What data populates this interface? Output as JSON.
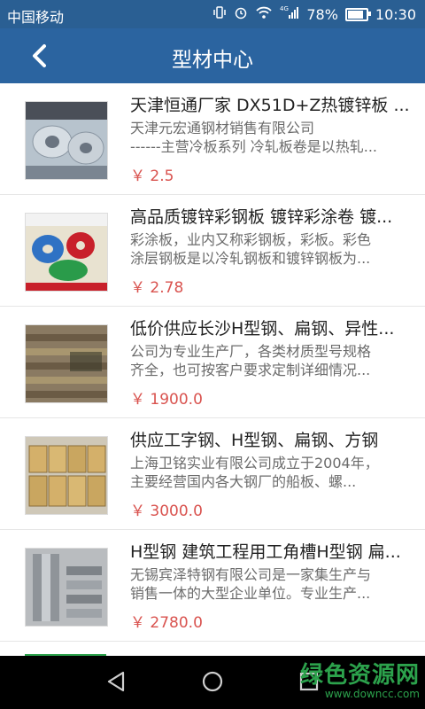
{
  "status": {
    "carrier": "中国移动",
    "battery_text": "78%",
    "battery_level": 0.78,
    "time": "10:30",
    "net": "4G"
  },
  "header": {
    "title": "型材中心"
  },
  "items": [
    {
      "name": "天津恒通厂家 DX51D+Z热镀锌板 ...",
      "desc1": "天津元宏通钢材销售有限公司",
      "desc2": "------主营冷板系列 冷轧板卷是以热轧...",
      "price": "￥ 2.5"
    },
    {
      "name": "高品质镀锌彩钢板 镀锌彩涂卷 镀...",
      "desc1": "彩涂板，业内又称彩钢板，彩板。彩色",
      "desc2": "涂层钢板是以冷轧钢板和镀锌钢板为...",
      "price": "￥ 2.78"
    },
    {
      "name": "低价供应长沙H型钢、扁钢、异性...",
      "desc1": "公司为专业生产厂，各类材质型号规格",
      "desc2": "齐全，也可按客户要求定制详细情况...",
      "price": "￥ 1900.0"
    },
    {
      "name": "供应工字钢、H型钢、扁钢、方钢",
      "desc1": "上海卫铭实业有限公司成立于2004年，",
      "desc2": "主要经营国内各大钢厂的船板、螺...",
      "price": "￥ 3000.0"
    },
    {
      "name": "H型钢 建筑工程用工角槽H型钢 扁...",
      "desc1": "无锡宾泽特钢有限公司是一家集生产与",
      "desc2": "销售一体的大型企业单位。专业生产...",
      "price": "￥ 2780.0"
    }
  ],
  "watermark": {
    "big": "绿色资源网",
    "small": "www.downcc.com"
  }
}
